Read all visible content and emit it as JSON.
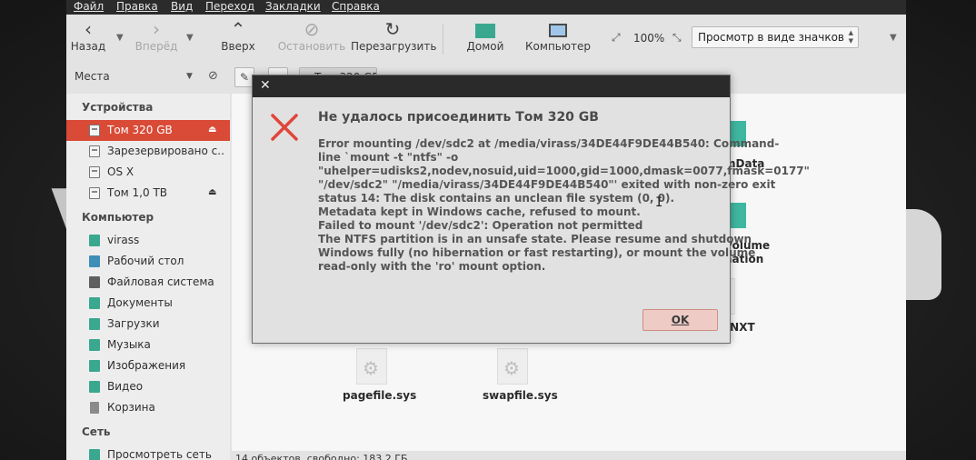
{
  "menubar": {
    "items": [
      "Файл",
      "Правка",
      "Вид",
      "Переход",
      "Закладки",
      "Справка"
    ]
  },
  "toolbar": {
    "back_label": "Назад",
    "forward_label": "Вперёд",
    "up_label": "Вверх",
    "stop_label": "Остановить",
    "reload_label": "Перезагрузить",
    "home_label": "Домой",
    "computer_label": "Компьютер",
    "zoom_value": "100%",
    "view_mode": "Просмотр в виде значков"
  },
  "location": {
    "places_label": "Места",
    "current_volume": "Том 320 GB"
  },
  "sidebar": {
    "devices_header": "Устройства",
    "devices": [
      {
        "label": "Том 320 GB",
        "icon": "drive-icon",
        "ejectable": true,
        "active": true
      },
      {
        "label": "Зарезервировано с...",
        "icon": "drive-icon",
        "ejectable": false,
        "active": false
      },
      {
        "label": "OS X",
        "icon": "drive-icon",
        "ejectable": false,
        "active": false
      },
      {
        "label": "Том 1,0 ТВ",
        "icon": "drive-icon",
        "ejectable": true,
        "active": false
      }
    ],
    "computer_header": "Компьютер",
    "computer": [
      {
        "label": "virass",
        "icon": "home-folder-icon"
      },
      {
        "label": "Рабочий стол",
        "icon": "desktop-icon"
      },
      {
        "label": "Файловая система",
        "icon": "filesystem-icon"
      },
      {
        "label": "Документы",
        "icon": "documents-folder-icon"
      },
      {
        "label": "Загрузки",
        "icon": "downloads-folder-icon"
      },
      {
        "label": "Музыка",
        "icon": "music-folder-icon"
      },
      {
        "label": "Изображения",
        "icon": "pictures-folder-icon"
      },
      {
        "label": "Видео",
        "icon": "videos-folder-icon"
      },
      {
        "label": "Корзина",
        "icon": "trash-icon"
      }
    ],
    "network_header": "Сеть",
    "network": [
      {
        "label": "Просмотреть сеть",
        "icon": "network-icon"
      }
    ]
  },
  "files": {
    "partial_1a": "mData",
    "partial_2a": "Volume",
    "partial_2b": "nation",
    "partial_3": "TNXT",
    "pagefile": "pagefile.sys",
    "swapfile": "swapfile.sys"
  },
  "status": {
    "text": "14 объектов, свободно: 183,2 ГБ"
  },
  "dialog": {
    "title": "Не удалось присоединить Том 320 GB",
    "lines": [
      "Error mounting /dev/sdc2 at /media/virass/34DE44F9DE44B540: Command-",
      "line `mount -t \"ntfs\" -o",
      "\"uhelper=udisks2,nodev,nosuid,uid=1000,gid=1000,dmask=0077,fmask=0177\"",
      "\"/dev/sdc2\" \"/media/virass/34DE44F9DE44B540\"' exited with non-zero exit",
      "status 14: The disk contains an unclean file system (0, 0).",
      "Metadata kept in Windows cache, refused to mount.",
      "Failed to mount '/dev/sdc2': Operation not permitted",
      "The NTFS partition is in an unsafe state. Please resume and shutdown",
      "Windows fully (no hibernation or fast restarting), or mount the volume",
      "read-only with the 'ro' mount option."
    ],
    "ok_label": "OK",
    "error_color": "#e0463a"
  }
}
